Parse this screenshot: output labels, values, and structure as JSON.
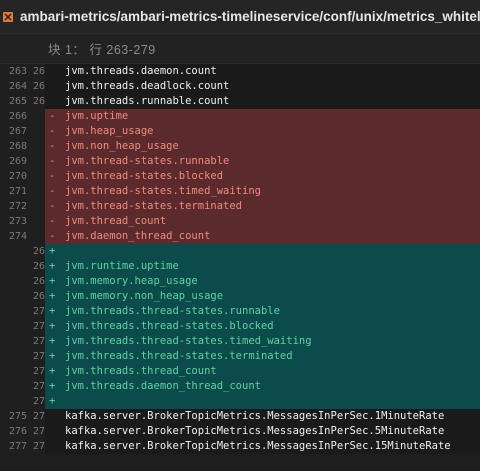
{
  "title": "ambari-metrics/ambari-metrics-timelineservice/conf/unix/metrics_whitelist",
  "hunk_label": "块 1： 行 263-279",
  "context_top": [
    {
      "num": "263",
      "num2": "26",
      "text": "jvm.threads.daemon.count"
    },
    {
      "num": "264",
      "num2": "26",
      "text": "jvm.threads.deadlock.count"
    },
    {
      "num": "265",
      "num2": "26",
      "text": "jvm.threads.runnable.count"
    }
  ],
  "deleted": [
    {
      "num": "266",
      "text": "jvm.uptime"
    },
    {
      "num": "267",
      "text": "jvm.heap_usage"
    },
    {
      "num": "268",
      "text": "jvm.non_heap_usage"
    },
    {
      "num": "269",
      "text": "jvm.thread-states.runnable"
    },
    {
      "num": "270",
      "text": "jvm.thread-states.blocked"
    },
    {
      "num": "271",
      "text": "jvm.thread-states.timed_waiting"
    },
    {
      "num": "272",
      "text": "jvm.thread-states.terminated"
    },
    {
      "num": "273",
      "text": "jvm.thread_count"
    },
    {
      "num": "274",
      "text": "jvm.daemon_thread_count"
    }
  ],
  "added": [
    {
      "num2": "26",
      "text": ""
    },
    {
      "num2": "26",
      "text": "jvm.runtime.uptime"
    },
    {
      "num2": "26",
      "text": "jvm.memory.heap_usage"
    },
    {
      "num2": "26",
      "text": "jvm.memory.non_heap_usage"
    },
    {
      "num2": "27",
      "text": "jvm.threads.thread-states.runnable"
    },
    {
      "num2": "27",
      "text": "jvm.threads.thread-states.blocked"
    },
    {
      "num2": "27",
      "text": "jvm.threads.thread-states.timed_waiting"
    },
    {
      "num2": "27",
      "text": "jvm.threads.thread-states.terminated"
    },
    {
      "num2": "27",
      "text": "jvm.threads.thread_count"
    },
    {
      "num2": "27",
      "text": "jvm.threads.daemon_thread_count"
    },
    {
      "num2": "27",
      "text": ""
    }
  ],
  "context_bottom": [
    {
      "num": "275",
      "num2": "27",
      "text": "kafka.server.BrokerTopicMetrics.MessagesInPerSec.1MinuteRate"
    },
    {
      "num": "276",
      "num2": "27",
      "text": "kafka.server.BrokerTopicMetrics.MessagesInPerSec.5MinuteRate"
    },
    {
      "num": "277",
      "num2": "27",
      "text": "kafka.server.BrokerTopicMetrics.MessagesInPerSec.15MinuteRate"
    }
  ],
  "colors": {
    "file_icon": "#e07b39",
    "deleted_bg": "#5b2a2c",
    "added_bg": "#0c4b4b"
  },
  "icons": {
    "file": "file-icon"
  }
}
